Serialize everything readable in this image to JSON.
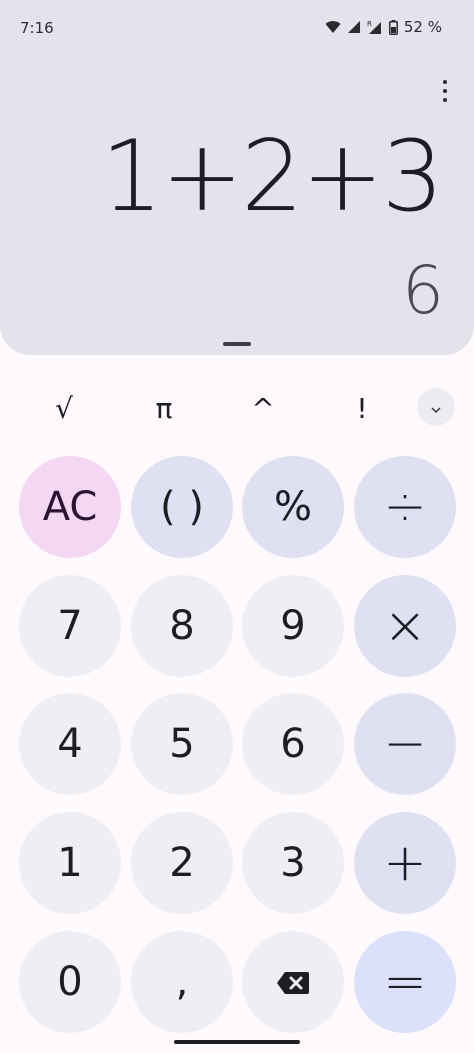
{
  "status": {
    "time": "7:16",
    "battery_percent": "52 %",
    "icons": [
      "wifi-icon",
      "signal-icon",
      "roaming-signal-icon",
      "battery-icon"
    ]
  },
  "display": {
    "expression": "1+2+3",
    "result": "6"
  },
  "scientific_row": [
    "√",
    "π",
    "^",
    "!"
  ],
  "keys": {
    "ac": "AC",
    "parens": "( )",
    "percent": "%",
    "divide": "÷",
    "seven": "7",
    "eight": "8",
    "nine": "9",
    "multiply": "×",
    "four": "4",
    "five": "5",
    "six": "6",
    "minus": "−",
    "one": "1",
    "two": "2",
    "three": "3",
    "plus": "+",
    "zero": "0",
    "decimal": ",",
    "equals": "="
  },
  "colors": {
    "display_bg": "#e3e3ec",
    "ac_bg": "#f4d8f3",
    "operator_bg": "#dfe1f3",
    "number_bg": "#efeff3",
    "equals_bg": "#dbe1fb"
  }
}
